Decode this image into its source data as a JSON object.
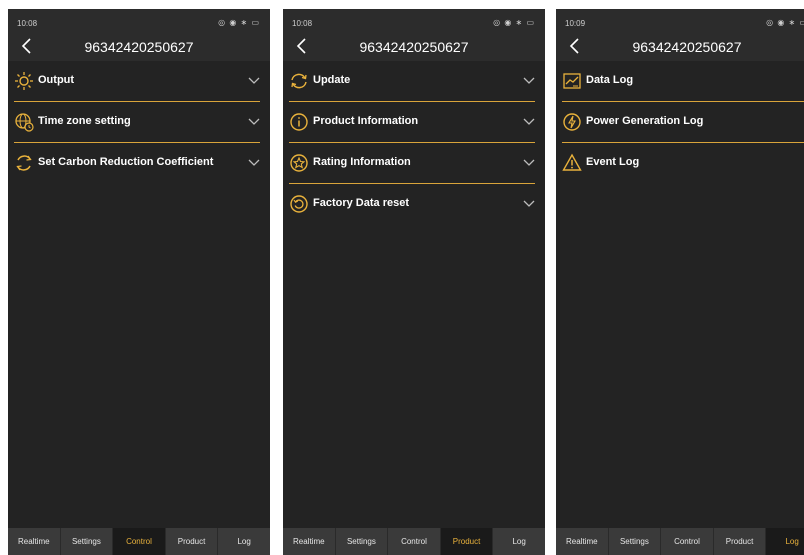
{
  "colors": {
    "accent": "#e9b23c",
    "background": "#232323",
    "tabbar": "#3a3a3a"
  },
  "tabs": [
    "Realtime",
    "Settings",
    "Control",
    "Product",
    "Log"
  ],
  "screens": [
    {
      "time": "10:08",
      "status_icons": "◎ ◉ ∗ ▭",
      "title": "96342420250627",
      "active_tab": "Control",
      "items": [
        {
          "label": "Output",
          "icon": "bulb-icon"
        },
        {
          "label": "Time zone setting",
          "icon": "globe-clock-icon"
        },
        {
          "label": "Set Carbon Reduction Coefficient",
          "icon": "refresh-circle-icon"
        }
      ]
    },
    {
      "time": "10:08",
      "status_icons": "◎ ◉ ∗ ▭",
      "title": "96342420250627",
      "active_tab": "Product",
      "items": [
        {
          "label": "Update",
          "icon": "refresh-icon"
        },
        {
          "label": "Product Information",
          "icon": "info-icon"
        },
        {
          "label": "Rating Information",
          "icon": "star-badge-icon"
        },
        {
          "label": "Factory Data reset",
          "icon": "reset-icon"
        }
      ]
    },
    {
      "time": "10:09",
      "status_icons": "◎ ◉ ∗ ▭",
      "title": "96342420250627",
      "active_tab": "Log",
      "items": [
        {
          "label": "Data Log",
          "icon": "chart-icon"
        },
        {
          "label": "Power Generation Log",
          "icon": "power-icon"
        },
        {
          "label": "Event Log",
          "icon": "warning-icon"
        }
      ]
    }
  ]
}
